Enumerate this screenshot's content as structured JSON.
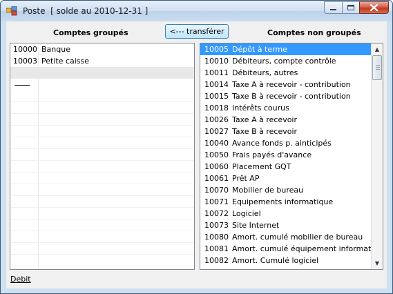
{
  "window": {
    "title": "Poste  [ solde au 2010-12-31 ]"
  },
  "headers": {
    "grouped": "Comptes groupés",
    "ungrouped": "Comptes non groupés"
  },
  "transfer_button": "<--- transférer",
  "grouped_accounts": [
    {
      "code": "10000",
      "name": "Banque"
    },
    {
      "code": "10003",
      "name": "Petite caisse"
    }
  ],
  "ungrouped_accounts": [
    {
      "code": "10005",
      "name": "Dépôt à terme",
      "selected": true
    },
    {
      "code": "10010",
      "name": "Débiteurs, compte contrôle"
    },
    {
      "code": "10011",
      "name": "Débiteurs, autres"
    },
    {
      "code": "10014",
      "name": "Taxe A à recevoir - contribution"
    },
    {
      "code": "10015",
      "name": "Taxe B à recevoir - contribution"
    },
    {
      "code": "10018",
      "name": "Intérêts courus"
    },
    {
      "code": "10026",
      "name": "Taxe A à recevoir"
    },
    {
      "code": "10027",
      "name": "Taxe B à recevoir"
    },
    {
      "code": "10040",
      "name": "Avance fonds p. ainticipés"
    },
    {
      "code": "10050",
      "name": "Frais payés d'avance"
    },
    {
      "code": "10060",
      "name": "Placement GQT"
    },
    {
      "code": "10061",
      "name": "Prêt AP"
    },
    {
      "code": "10070",
      "name": "Mobilier de bureau"
    },
    {
      "code": "10071",
      "name": "Equipements informatique"
    },
    {
      "code": "10072",
      "name": "Logiciel"
    },
    {
      "code": "10073",
      "name": "Site Internet"
    },
    {
      "code": "10080",
      "name": "Amort. cumulé mobilier de bureau"
    },
    {
      "code": "10081",
      "name": "Amort. cumulé équipement informatique"
    },
    {
      "code": "10082",
      "name": "Amort. Cumulé logiciel"
    }
  ],
  "footer": {
    "link": "Debit"
  },
  "colors": {
    "selection": "#3399ff",
    "client_background": "#f0f0f0",
    "title_gradient": "#cddff1"
  },
  "icons": {
    "app": "app-icon",
    "minimize": "minimize-icon",
    "maximize": "maximize-icon",
    "close": "close-icon",
    "scroll_up": "scroll-up-arrow-icon",
    "scroll_down": "scroll-down-arrow-icon"
  }
}
